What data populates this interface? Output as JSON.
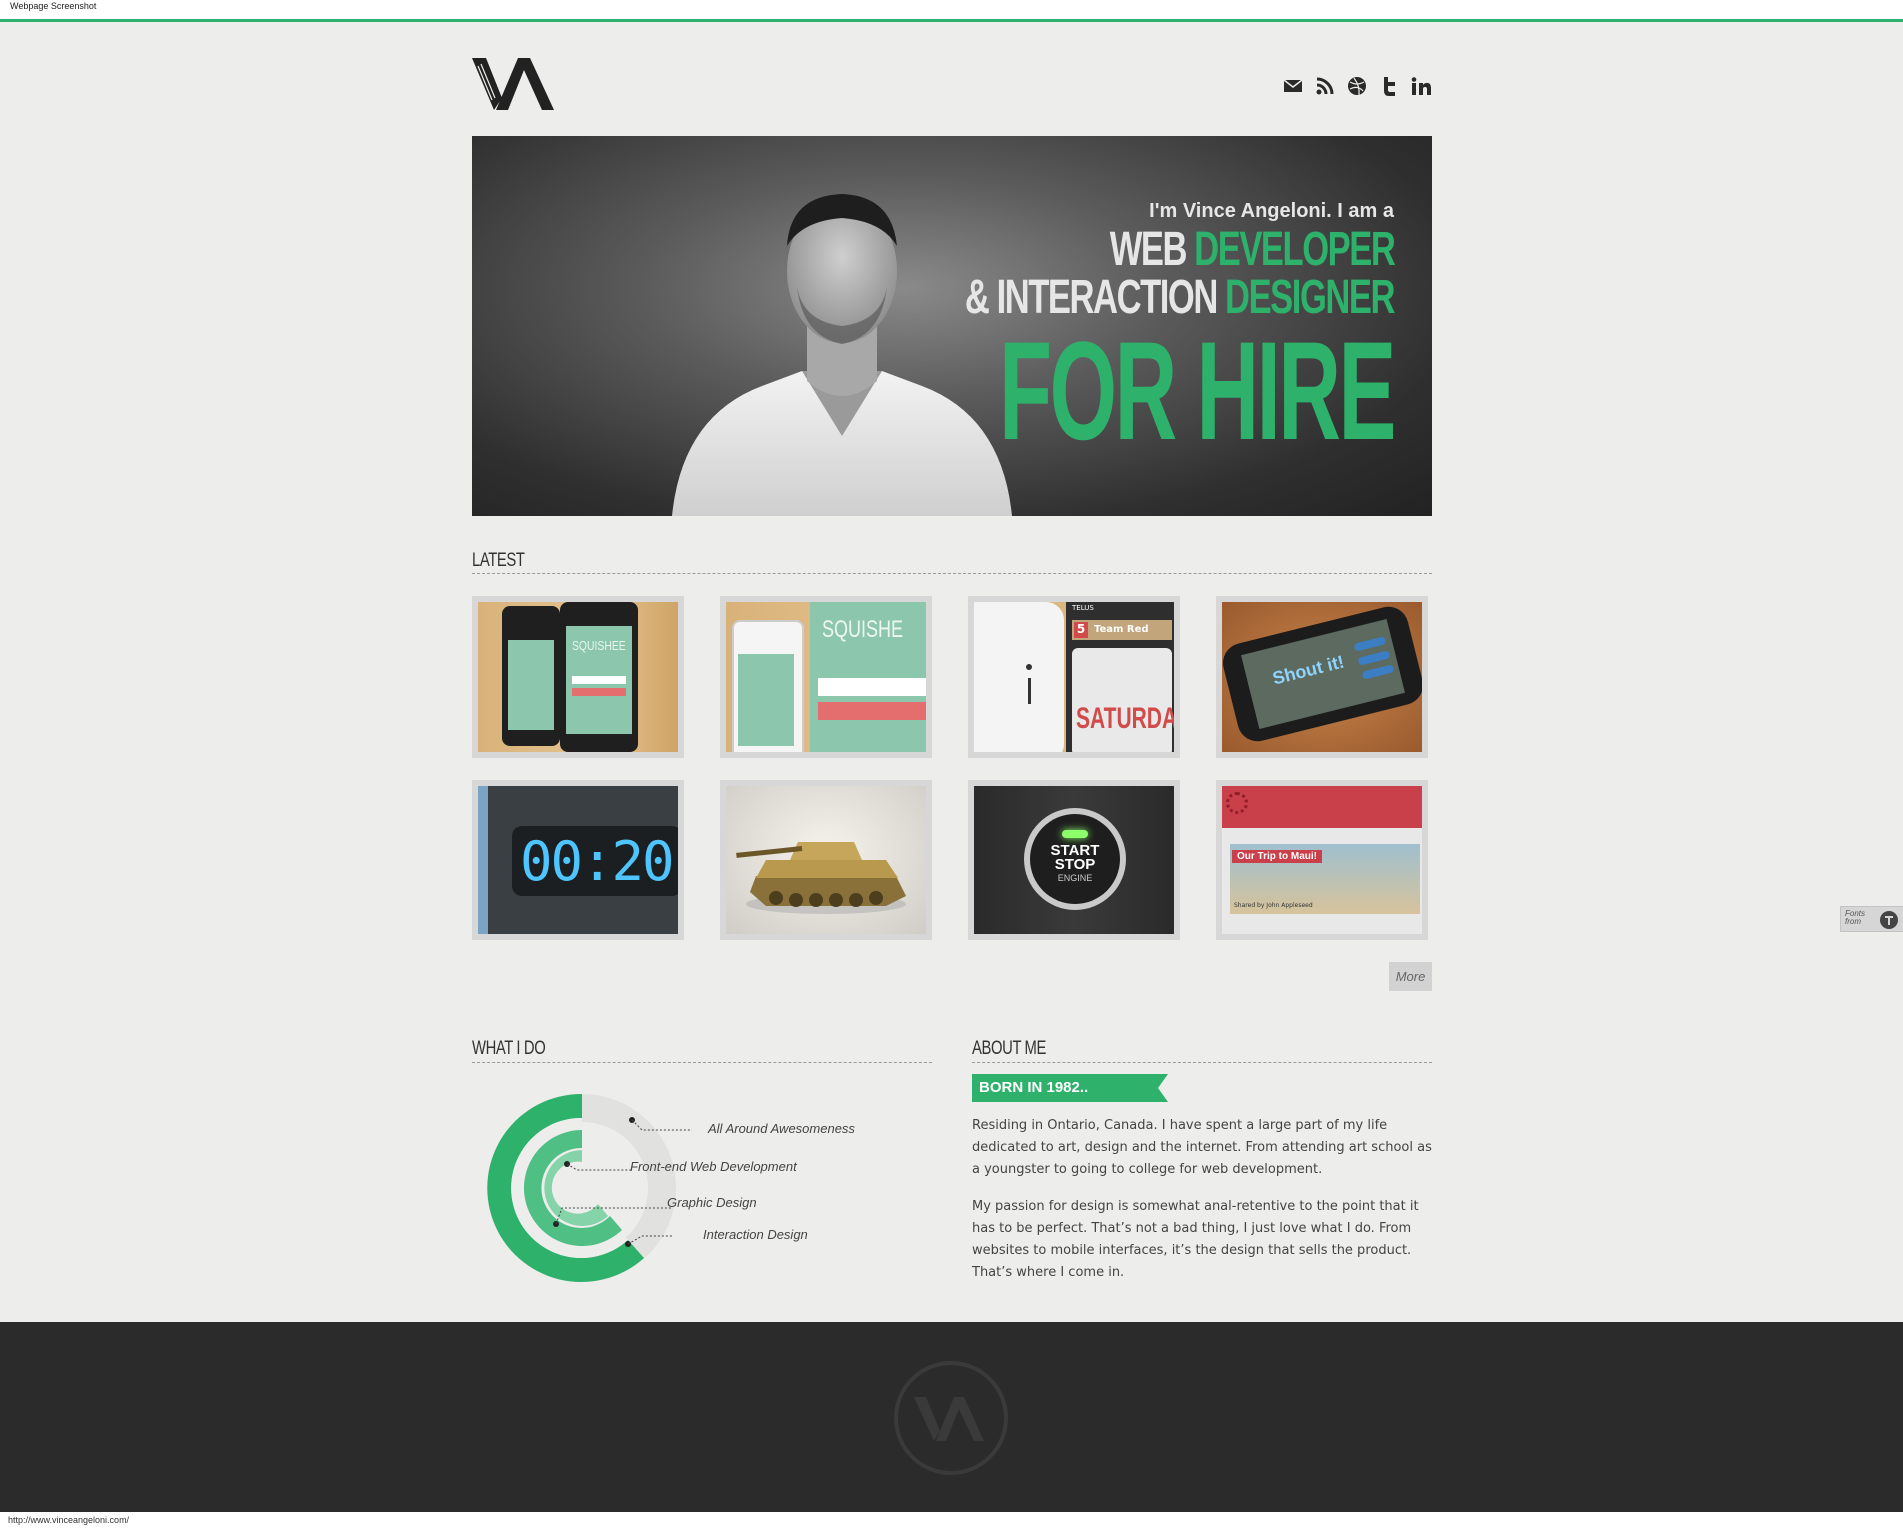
{
  "window": {
    "title": "Webpage Screenshot"
  },
  "header": {
    "logo_alt": "VA",
    "social": [
      {
        "name": "email",
        "icon": "envelope-icon"
      },
      {
        "name": "rss",
        "icon": "rss-icon"
      },
      {
        "name": "dribbble",
        "icon": "dribbble-icon"
      },
      {
        "name": "twitter",
        "icon": "twitter-icon"
      },
      {
        "name": "linkedin",
        "icon": "linkedin-icon"
      }
    ]
  },
  "hero": {
    "intro": "I'm Vince Angeloni. I am a",
    "role1_white": "WEB ",
    "role1_green": "DEVELOPER",
    "role2_white": "& INTERACTION ",
    "role2_green": "DESIGNER",
    "cta": "FOR HIRE"
  },
  "latest": {
    "title": "LATEST",
    "items": [
      {
        "name": "Squishee app",
        "text": "SQUISHEE"
      },
      {
        "name": "Squishee screens",
        "text": "SQUISHE"
      },
      {
        "name": "Team Red",
        "text": "Team Red",
        "number": "5",
        "carrier": "TELUS",
        "day": "SATURDA"
      },
      {
        "name": "Shout It",
        "text": "Shout it!"
      },
      {
        "name": "Timer",
        "text": "00:20"
      },
      {
        "name": "Tank",
        "text": ""
      },
      {
        "name": "Start Stop Engine",
        "line1": "START",
        "line2": "STOP",
        "line3": "ENGINE"
      },
      {
        "name": "Our Trip to Maui",
        "text": "Our Trip to Maui!",
        "caption": "Shared by John Appleseed"
      }
    ],
    "more_label": "More"
  },
  "what_i_do": {
    "title": "WHAT I DO",
    "skills": [
      {
        "label": "All Around Awesomeness",
        "level": 1.0
      },
      {
        "label": "Front-end Web Development",
        "level": 0.75
      },
      {
        "label": "Graphic Design",
        "level": 0.6
      },
      {
        "label": "Interaction Design",
        "level": 0.55
      }
    ],
    "colors": {
      "accent": "#2db16b"
    }
  },
  "about": {
    "title": "ABOUT ME",
    "ribbon": "BORN IN 1982..",
    "p1": "Residing in Ontario, Canada. I have spent a large part of my life dedicated to art, design and the internet. From attending art school as a youngster to going to college for web development.",
    "p2": "My passion for design is somewhat anal-retentive to the point that it has to be perfect. That’s not a bad thing, I just love what I do. From websites to mobile interfaces, it’s the design that sells the product. That’s where I come in."
  },
  "fonts_badge": {
    "line1": "Fonts",
    "line2": "from"
  },
  "status": {
    "url": "http://www.vinceangeloni.com/"
  },
  "colors": {
    "accent": "#2db16b",
    "background": "#ededeb",
    "footer": "#2b2b2b"
  }
}
